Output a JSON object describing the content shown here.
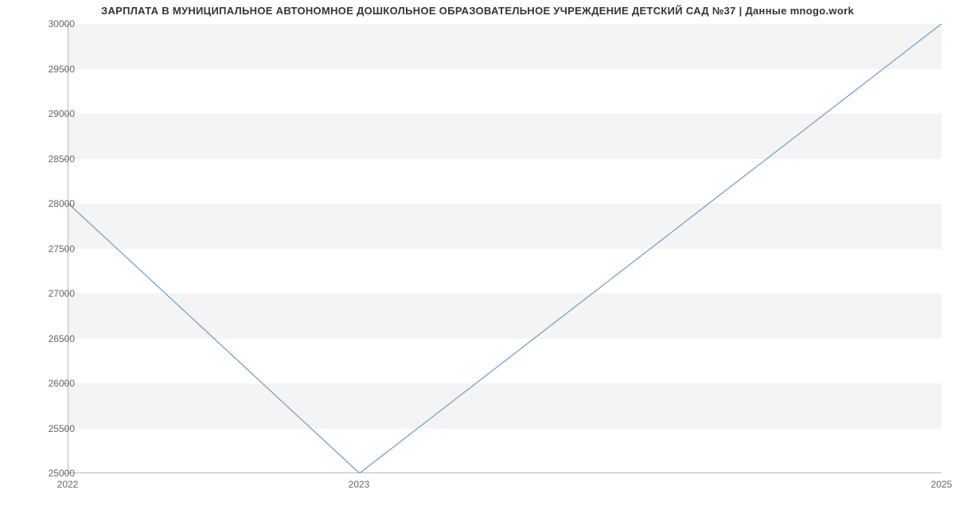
{
  "chart_data": {
    "type": "line",
    "title": "ЗАРПЛАТА В МУНИЦИПАЛЬНОЕ АВТОНОМНОЕ ДОШКОЛЬНОЕ ОБРАЗОВАТЕЛЬНОЕ УЧРЕЖДЕНИЕ  ДЕТСКИЙ САД №37 | Данные mnogo.work",
    "x": [
      2022,
      2023,
      2025
    ],
    "values": [
      28000,
      25000,
      30000
    ],
    "xlabel": "",
    "ylabel": "",
    "x_ticks": [
      2022,
      2023,
      2025
    ],
    "y_ticks": [
      25000,
      25500,
      26000,
      26500,
      27000,
      27500,
      28000,
      28500,
      29000,
      29500,
      30000
    ],
    "xlim": [
      2022,
      2025
    ],
    "ylim": [
      25000,
      30000
    ],
    "grid": true,
    "line_color": "#6b9bd1"
  }
}
